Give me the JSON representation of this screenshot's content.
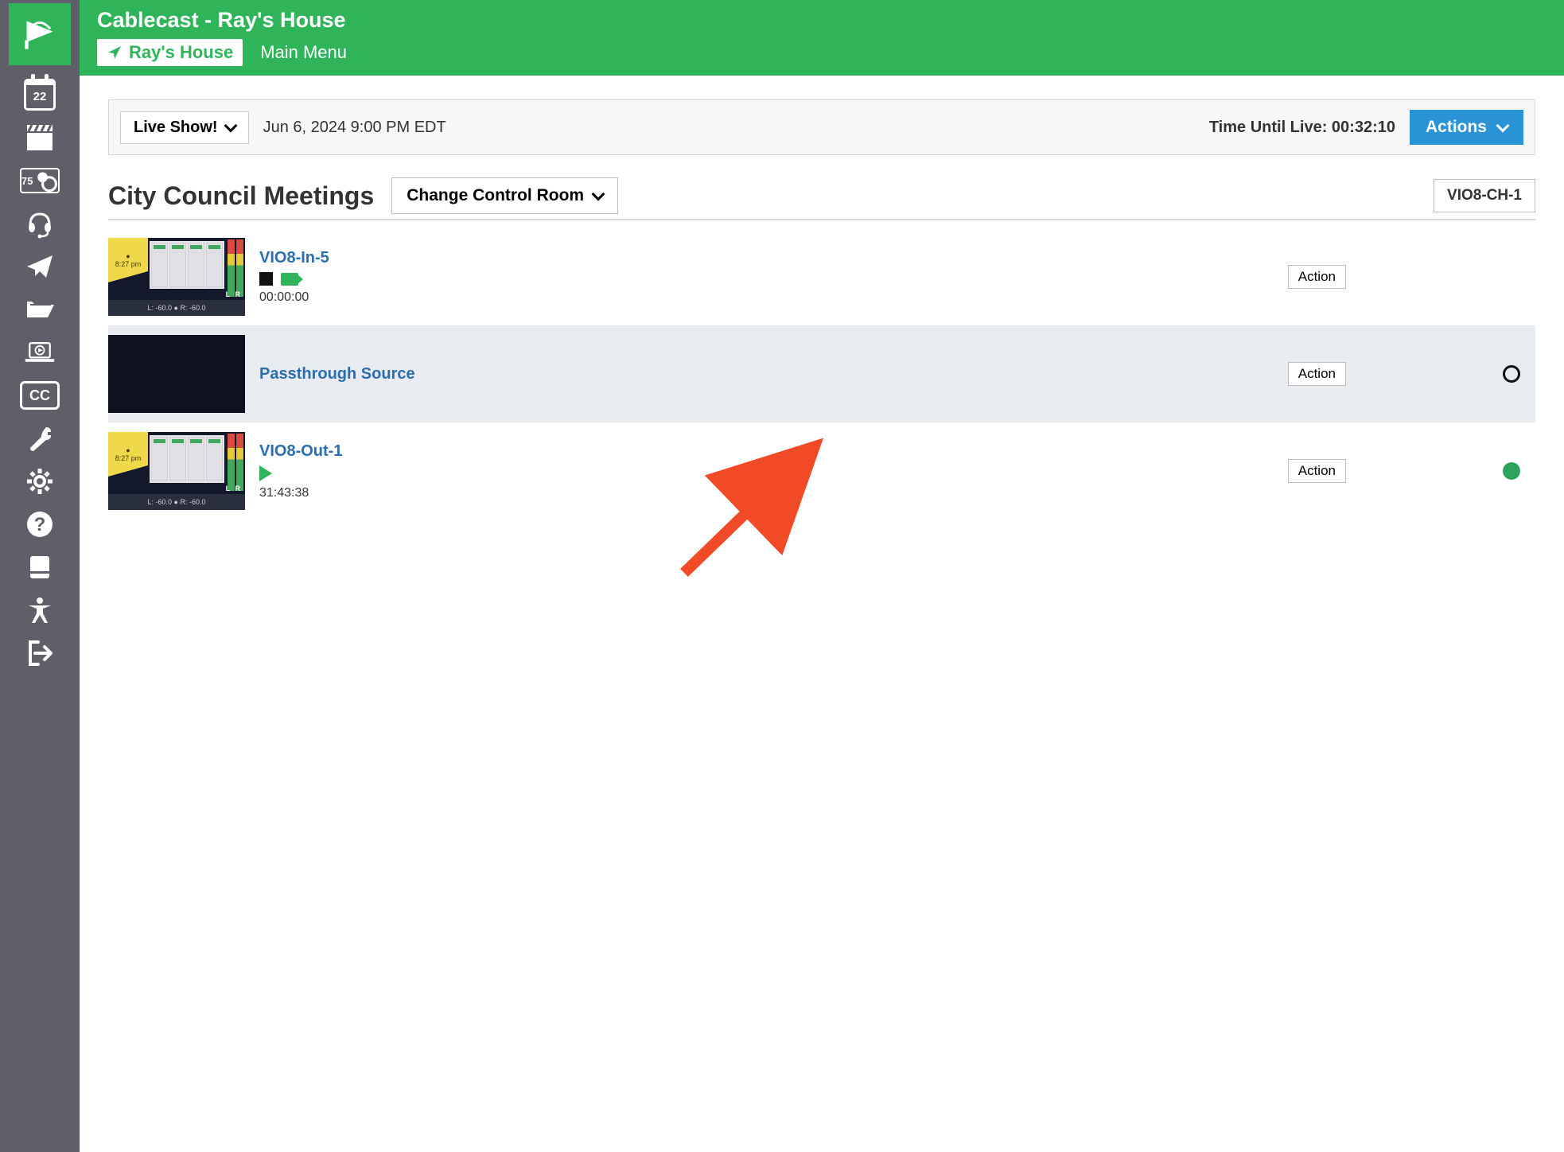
{
  "app_title": "Cablecast - Ray's House",
  "location_chip": "Ray's House",
  "main_menu_label": "Main Menu",
  "sidebar": {
    "calendar_date": "22",
    "thermo_value": "75"
  },
  "live_bar": {
    "live_button": "Live Show!",
    "datetime": "Jun 6, 2024 9:00 PM EDT",
    "countdown_label": "Time Until Live: ",
    "countdown_value": "00:32:10",
    "actions_label": "Actions"
  },
  "page": {
    "title": "City Council Meetings",
    "change_room_label": "Change Control Room",
    "channel_badge": "VIO8-CH-1"
  },
  "sources": [
    {
      "name": "VIO8-In-5",
      "time": "00:00:00",
      "thumb_clock": "8:27 pm",
      "thumb_levels": "L: -60.0  ●  R: -60.0",
      "action_label": "Action",
      "status": "recording-stopped"
    },
    {
      "name": "Passthrough Source",
      "action_label": "Action",
      "status": "empty"
    },
    {
      "name": "VIO8-Out-1",
      "time": "31:43:38",
      "thumb_clock": "8:27 pm",
      "thumb_levels": "L: -60.0  ●  R: -60.0",
      "action_label": "Action",
      "status": "playing"
    }
  ]
}
